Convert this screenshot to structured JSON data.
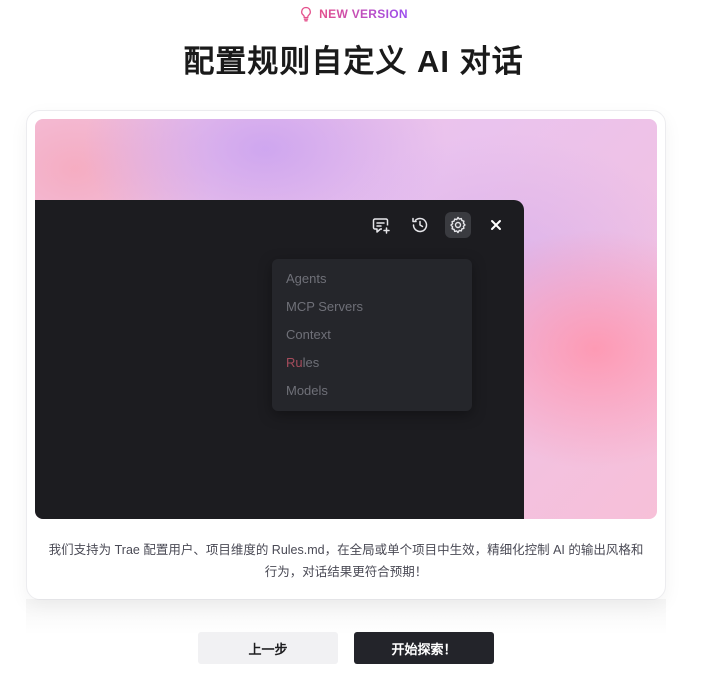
{
  "badge": {
    "icon": "lightbulb-icon",
    "text": "NEW VERSION"
  },
  "title": "配置规则自定义 AI 对话",
  "hero": {
    "toolbar": [
      {
        "icon": "new-chat-icon"
      },
      {
        "icon": "history-icon"
      },
      {
        "icon": "gear-icon",
        "active": true
      },
      {
        "icon": "close-icon"
      }
    ],
    "menu": {
      "items": [
        {
          "label": "Agents"
        },
        {
          "label": "MCP Servers"
        },
        {
          "label": "Context"
        },
        {
          "label_highlight": "Ru",
          "label_rest": "les"
        },
        {
          "label": "Models"
        }
      ]
    }
  },
  "description": "我们支持为 Trae 配置用户、项目维度的 Rules.md，在全局或单个项目中生效，精细化控制 AI 的输出风格和行为，对话结果更符合预期！",
  "buttons": {
    "prev": "上一步",
    "start": "开始探索！"
  },
  "colors": {
    "accent_start": "#e4508c",
    "accent_end": "#9a4cf0",
    "primary_button": "#23242a"
  }
}
